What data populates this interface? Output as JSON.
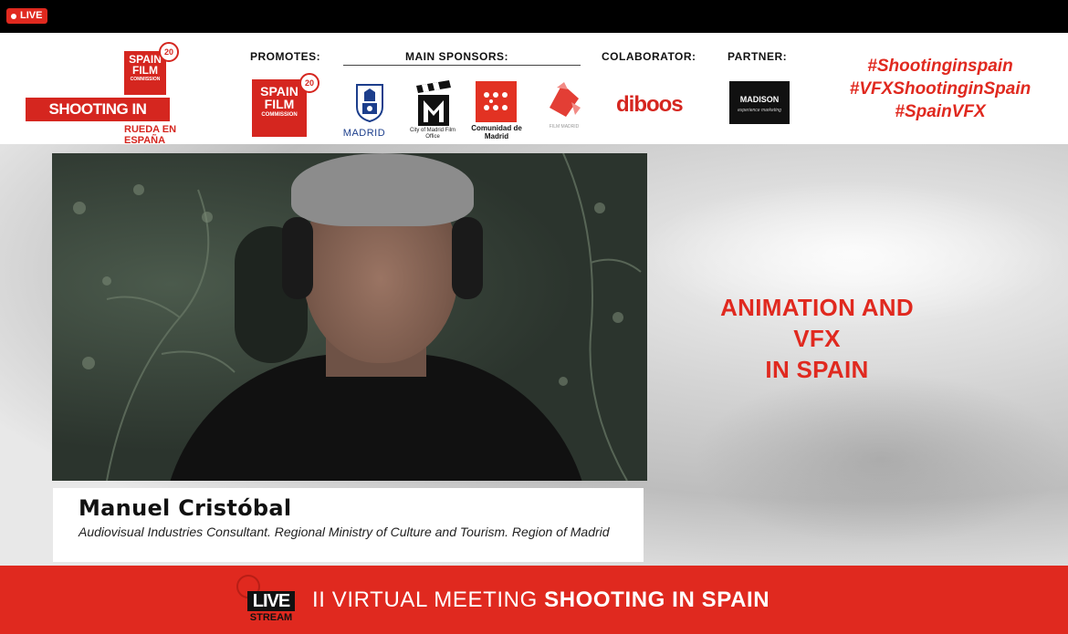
{
  "window": {
    "live_badge": "LIVE"
  },
  "sponsors": {
    "main_logo": {
      "line1": "SPAIN",
      "line2": "FILM",
      "line3": "COMMISSION",
      "badge": "20",
      "bar": "SHOOTING IN SPAIN",
      "sub": "RUEDA EN ESPAÑA"
    },
    "promotes_label": "PROMOTES:",
    "promotes_logo": {
      "line1": "SPAIN",
      "line2": "FILM",
      "line3": "COMMISSION",
      "badge": "20"
    },
    "main_sponsors_label": "MAIN SPONSORS:",
    "madrid_text": "MADRID",
    "cityoffice_text": "City of Madrid Film Office",
    "comunidad_text": "Comunidad de Madrid",
    "filmmadrid_text": "FILM MADRID",
    "colaborator_label": "COLABORATOR:",
    "diboos_text": "diboos",
    "partner_label": "PARTNER:",
    "madison_text": "MADISON",
    "madison_sub": "experience marketing"
  },
  "hashtags": [
    "#Shootinginspain",
    "#VFXShootinginSpain",
    "#SpainVFX"
  ],
  "speaker": {
    "name": "Manuel Cristóbal",
    "role": "Audiovisual Industries Consultant. Regional Ministry of Culture and Tourism. Region of Madrid"
  },
  "topic": {
    "line1": "ANIMATION AND VFX",
    "line2": "IN SPAIN"
  },
  "footer": {
    "live_label": "LIVE",
    "stream_label": "STREAM",
    "event_prefix": "II VIRTUAL MEETING ",
    "event_bold": "SHOOTING IN SPAIN"
  },
  "colors": {
    "brand_red": "#e0291f",
    "topbar": "#000000",
    "madrid_blue": "#1c3e8c"
  }
}
